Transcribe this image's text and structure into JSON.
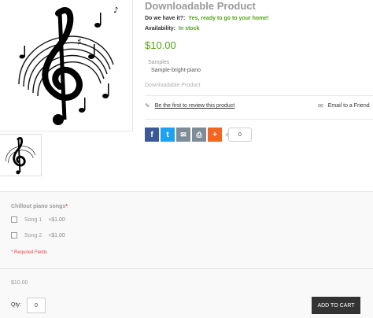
{
  "product": {
    "title": "Downloadable Product",
    "do_we_have_label": "Do we have it?:",
    "do_we_have_value": "Yes, ready to go to your home!",
    "availability_label": "Availability:",
    "availability_value": "In stock",
    "price": "$10.00",
    "samples_label": "Samples",
    "sample_link": "Sample-bright-piano",
    "download_label": "Downloadable Product"
  },
  "actions": {
    "review_link": "Be the first to review this product",
    "email_friend": "Email to a Friend"
  },
  "share": {
    "buttons": [
      {
        "icon": "facebook-icon",
        "glyph": "f",
        "color": "#3b5998"
      },
      {
        "icon": "twitter-icon",
        "glyph": "t",
        "color": "#1da1f2"
      },
      {
        "icon": "email-icon",
        "glyph": "✉",
        "color": "#7d8c96"
      },
      {
        "icon": "print-icon",
        "glyph": "⎙",
        "color": "#7d8c96"
      },
      {
        "icon": "plus-icon",
        "glyph": "+",
        "color": "#f26522"
      }
    ],
    "count": "0"
  },
  "options": {
    "title": "Chillout piano songs",
    "required_mark": "*",
    "items": [
      {
        "label": "Song 1",
        "price": "+$1.00"
      },
      {
        "label": "Song 2",
        "price": "+$1.00"
      }
    ],
    "required_note": "* Required Fields"
  },
  "purchase": {
    "price": "$10.00",
    "qty_label": "Qty:",
    "qty_value": "0",
    "add_to_cart": "ADD TO CART"
  }
}
